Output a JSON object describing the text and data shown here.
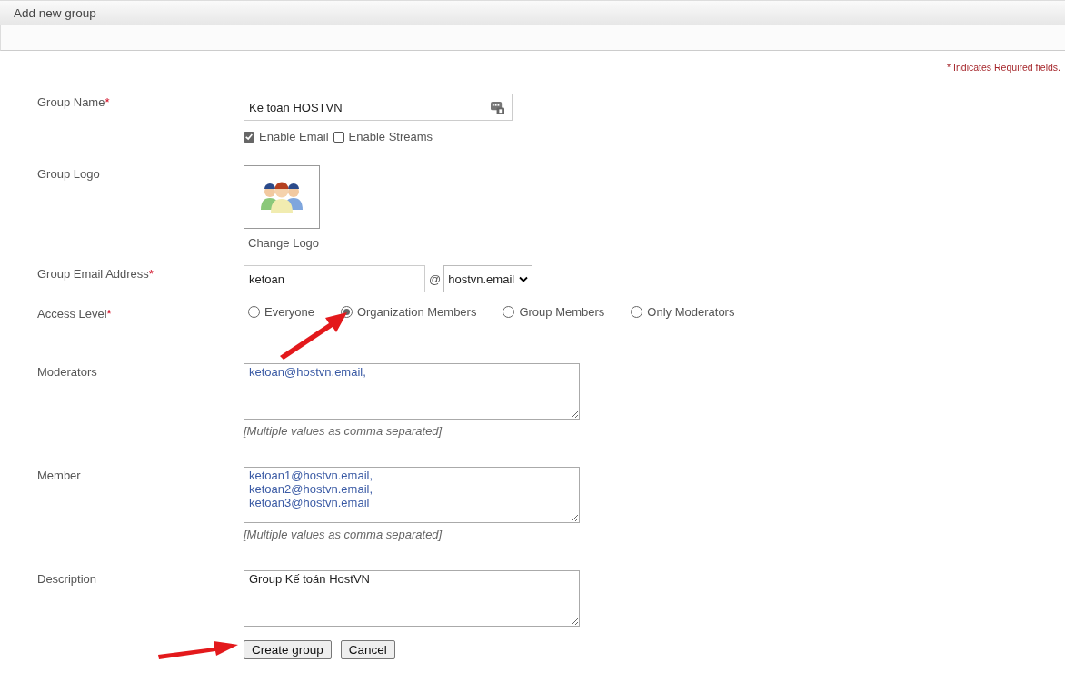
{
  "header": {
    "title": "Add new group"
  },
  "required_note": "* Indicates Required fields.",
  "group_name": {
    "label": "Group Name",
    "required_mark": "*",
    "value": "Ke toan HOSTVN"
  },
  "options": [
    {
      "label": "Enable Email",
      "checked": true
    },
    {
      "label": "Enable Streams",
      "checked": false
    }
  ],
  "group_logo": {
    "label": "Group Logo",
    "link": "Change Logo"
  },
  "email": {
    "label": "Group Email Address",
    "required_mark": "*",
    "value": "ketoan",
    "separator": "@",
    "domain": "hostvn.email"
  },
  "access_level": {
    "label": "Access Level",
    "required_mark": "*",
    "options": [
      {
        "label": "Everyone",
        "selected": false
      },
      {
        "label": "Organization Members",
        "selected": true
      },
      {
        "label": "Group Members",
        "selected": false
      },
      {
        "label": "Only Moderators",
        "selected": false
      }
    ]
  },
  "moderators": {
    "label": "Moderators",
    "value": "ketoan@hostvn.email,",
    "hint": "[Multiple values as comma separated]"
  },
  "member": {
    "label": "Member",
    "value": "ketoan1@hostvn.email,\nketoan2@hostvn.email,\nketoan3@hostvn.email",
    "hint": "[Multiple values as comma separated]"
  },
  "description": {
    "label": "Description",
    "value": "Group Kế toán HostVN"
  },
  "buttons": [
    {
      "label": "Create group"
    },
    {
      "label": "Cancel"
    }
  ]
}
